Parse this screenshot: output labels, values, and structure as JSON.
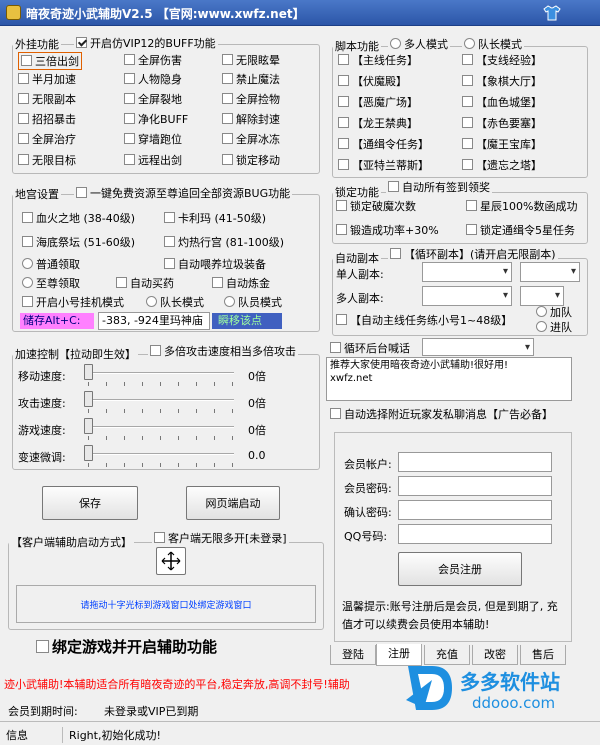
{
  "window": {
    "title": "暗夜奇迹小武辅助V2.5 【官网:www.xwfz.net】"
  },
  "icons": {
    "app": "app-icon",
    "skin": "tshirt-icon",
    "drag": "crosshair-icon"
  },
  "plugin": {
    "legend": "外挂功能",
    "vip_label": "开启仿VIP12的BUFF功能",
    "vip_checked": true,
    "items": [
      {
        "label": "三倍出剑",
        "checked": false
      },
      {
        "label": "全屏伤害",
        "checked": false
      },
      {
        "label": "无限眩晕",
        "checked": false
      },
      {
        "label": "半月加速",
        "checked": false
      },
      {
        "label": "人物隐身",
        "checked": false
      },
      {
        "label": "禁止魔法",
        "checked": false
      },
      {
        "label": "无限副本",
        "checked": false
      },
      {
        "label": "全屏裂地",
        "checked": false
      },
      {
        "label": "全屏捡物",
        "checked": false
      },
      {
        "label": "招招暴击",
        "checked": false
      },
      {
        "label": "净化BUFF",
        "checked": false
      },
      {
        "label": "解除封速",
        "checked": false
      },
      {
        "label": "全屏治疗",
        "checked": false
      },
      {
        "label": "穿墙跑位",
        "checked": false
      },
      {
        "label": "全屏冰冻",
        "checked": false
      },
      {
        "label": "无限目标",
        "checked": false
      },
      {
        "label": "远程出剑",
        "checked": false
      },
      {
        "label": "锁定移动",
        "checked": false
      }
    ]
  },
  "palace": {
    "legend": "地宫设置",
    "bug_label": "一键免费资源至尊追回全部资源BUG功能",
    "dungeons": [
      "血火之地 (38-40级)",
      "卡利玛 (41-50级)",
      "海底祭坛 (51-60级)",
      "灼热行宫 (81-100级)"
    ],
    "normal": "普通领取",
    "supreme": "至尊领取",
    "auto_feed": "自动喂养垃圾装备",
    "auto_buy": "自动买药",
    "auto_refine": "自动炼金",
    "hangup": "开启小号挂机模式",
    "leader": "队长模式",
    "member": "队员模式",
    "store_label": "储存Alt+C:",
    "coord_value": "-383, -924里玛神庙",
    "move_label": "瞬移该点"
  },
  "speed": {
    "legend": "加速控制【拉动即生效】",
    "multi_label": "多倍攻击速度相当多倍攻击",
    "sliders": [
      {
        "label": "移动速度:",
        "value": "0倍",
        "level": 0
      },
      {
        "label": "攻击速度:",
        "value": "0倍",
        "level": 0
      },
      {
        "label": "游戏速度:",
        "value": "0倍",
        "level": 0
      },
      {
        "label": "变速微调:",
        "value": "0.0",
        "level": 0
      }
    ]
  },
  "buttons": {
    "save": "保存",
    "web_start": "网页端启动",
    "register": "会员注册"
  },
  "client": {
    "legend": "【客户端辅助启动方式】",
    "multi_open": "客户端无限多开[未登录]",
    "hint": "请拖动十字光标到游戏窗口处绑定游戏窗口",
    "bind": "绑定游戏并开启辅助功能"
  },
  "script": {
    "legend": "脚本功能",
    "multi": "多人模式",
    "leader": "队长模式",
    "items": [
      "【主线任务】",
      "【支线经验】",
      "【伏魔殿】",
      "【象棋大厅】",
      "【恶魔广场】",
      "【血色城堡】",
      "【龙王禁典】",
      "【赤色要塞】",
      "【通缉令任务】",
      "【魔王宝库】",
      "【亚特兰蒂斯】",
      "【遗忘之塔】"
    ]
  },
  "lock": {
    "legend": "锁定功能",
    "auto_sign": "自动所有签到领奖",
    "items": [
      "锁定破魔次数",
      "星辰100%数函成功",
      "锻造成功率+30%",
      "锁定通缉令5星任务"
    ]
  },
  "auto_dungeon": {
    "legend": "自动副本",
    "loop": "【循环副本】(请开启无限副本)",
    "single": "单人副本:",
    "multi": "多人副本:",
    "mainline": "【自动主线任务练小号1~48级】",
    "join": "加队",
    "leave": "进队"
  },
  "loop_shout": {
    "label": "循环后台喊话",
    "message": "推荐大家使用暗夜奇迹小武辅助!很好用!\nxwfz.net",
    "auto_reply": "自动选择附近玩家发私聊消息【广告必备】"
  },
  "account": {
    "user": "会员帐户:",
    "pass": "会员密码:",
    "confirm": "确认密码:",
    "qq": "QQ号码:",
    "tip": "温馨提示:账号注册后是会员, 但是到期了, 充值才可以续费会员使用本辅助!"
  },
  "tabs": [
    "登陆",
    "注册",
    "充值",
    "改密",
    "售后"
  ],
  "marquee": "迹小武辅助!本辅助适合所有暗夜奇迹的平台,稳定奔放,高调不封号!辅助",
  "status": {
    "expire_label": "会员到期时间:",
    "expire_value": "未登录或VIP已到期",
    "info_label": "信息",
    "info_value": "Right,初始化成功!"
  },
  "watermark": {
    "brand": "多多软件站",
    "url": "ddooo.com"
  },
  "colors": {
    "title_bar": "#2c56a8",
    "marquee": "#ff0000",
    "pink": "#ff80ff",
    "blue": "#4060c0",
    "hint": "#0040ff"
  }
}
